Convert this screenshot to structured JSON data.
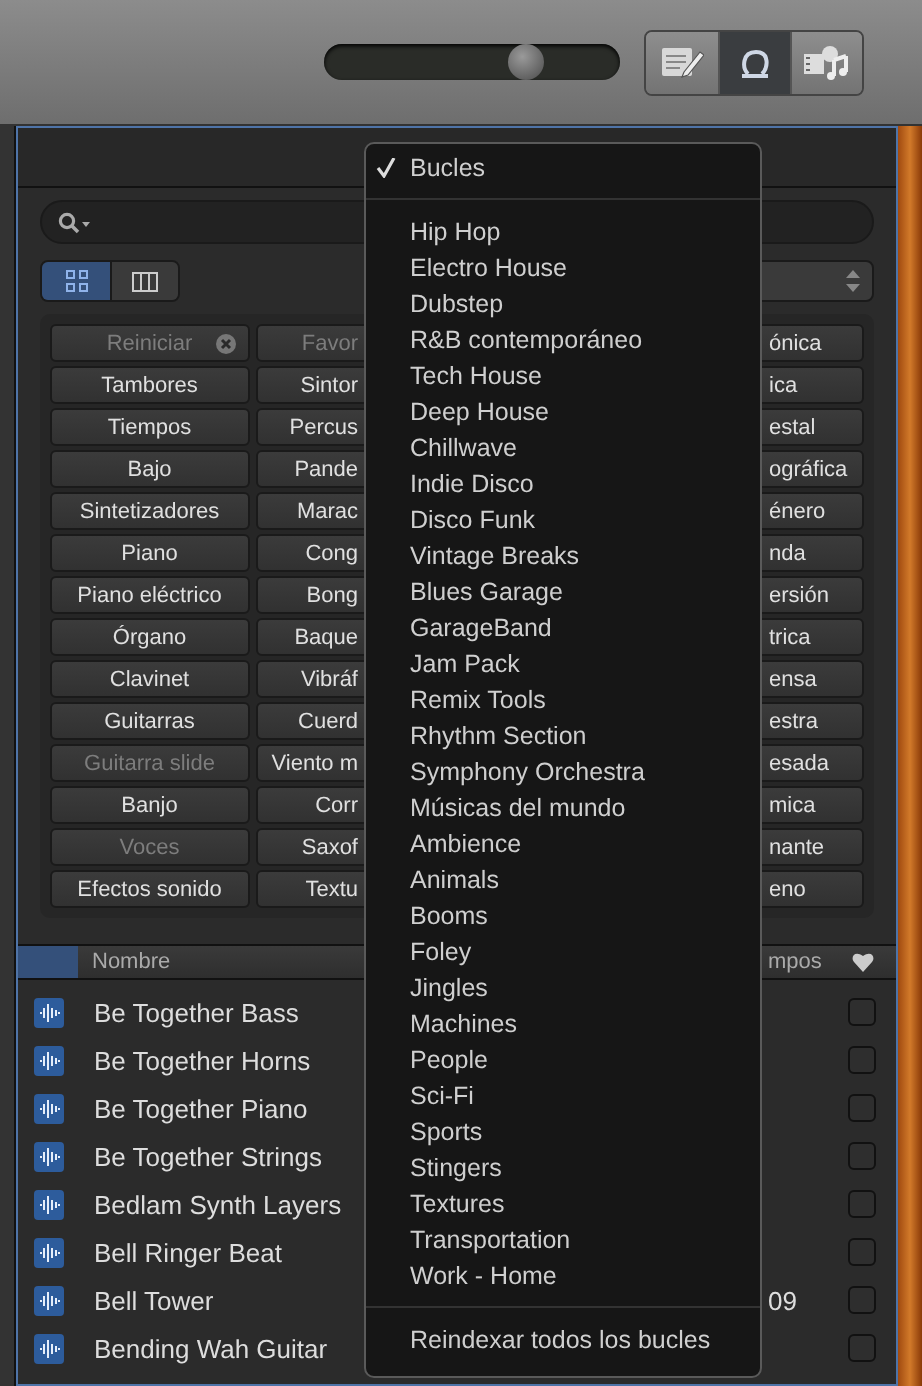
{
  "toolbar": {
    "slider": {
      "level": 0.68
    },
    "view_buttons": [
      {
        "kind": "editor",
        "selected": false
      },
      {
        "kind": "loops",
        "selected": true
      },
      {
        "kind": "media",
        "selected": false
      }
    ]
  },
  "view_toggle": [
    {
      "kind": "grid",
      "selected": true
    },
    {
      "kind": "columns",
      "selected": false
    }
  ],
  "keyword_columns": [
    [
      {
        "label": "Reiniciar",
        "disabled": true,
        "kind": "reset"
      },
      {
        "label": "Tambores",
        "disabled": false
      },
      {
        "label": "Tiempos",
        "disabled": false
      },
      {
        "label": "Bajo",
        "disabled": false
      },
      {
        "label": "Sintetizadores",
        "disabled": false
      },
      {
        "label": "Piano",
        "disabled": false
      },
      {
        "label": "Piano eléctrico",
        "disabled": false
      },
      {
        "label": "Órgano",
        "disabled": false
      },
      {
        "label": "Clavinet",
        "disabled": false
      },
      {
        "label": "Guitarras",
        "disabled": false
      },
      {
        "label": "Guitarra slide",
        "disabled": true
      },
      {
        "label": "Banjo",
        "disabled": false
      },
      {
        "label": "Voces",
        "disabled": true
      },
      {
        "label": "Efectos sonido",
        "disabled": false
      }
    ],
    [
      {
        "label": "Favor",
        "disabled": true
      },
      {
        "label": "Sintor",
        "disabled": false
      },
      {
        "label": "Percus",
        "disabled": false
      },
      {
        "label": "Pande",
        "disabled": false
      },
      {
        "label": "Marac",
        "disabled": false
      },
      {
        "label": "Cong",
        "disabled": false
      },
      {
        "label": "Bong",
        "disabled": false
      },
      {
        "label": "Baque",
        "disabled": false
      },
      {
        "label": "Vibráf",
        "disabled": false
      },
      {
        "label": "Cuerd",
        "disabled": false
      },
      {
        "label": "Viento m",
        "disabled": false
      },
      {
        "label": "Corr",
        "disabled": false
      },
      {
        "label": "Saxof",
        "disabled": false
      },
      {
        "label": "Textu",
        "disabled": false
      }
    ],
    [
      {
        "label": "ónica",
        "disabled": false
      },
      {
        "label": "ica",
        "disabled": false
      },
      {
        "label": "estal",
        "disabled": false
      },
      {
        "label": "ográfica",
        "disabled": false
      },
      {
        "label": "énero",
        "disabled": false
      },
      {
        "label": "nda",
        "disabled": false
      },
      {
        "label": "ersión",
        "disabled": false
      },
      {
        "label": "trica",
        "disabled": false
      },
      {
        "label": "ensa",
        "disabled": false
      },
      {
        "label": "estra",
        "disabled": false
      },
      {
        "label": "esada",
        "disabled": false
      },
      {
        "label": "mica",
        "disabled": false
      },
      {
        "label": "nante",
        "disabled": false
      },
      {
        "label": "eno",
        "disabled": false
      }
    ]
  ],
  "table": {
    "columns": [
      "Nombre",
      "mpos"
    ],
    "rows": [
      {
        "name": "Be Together Bass",
        "favorite": false
      },
      {
        "name": "Be Together Horns",
        "favorite": false
      },
      {
        "name": "Be Together Piano",
        "favorite": false
      },
      {
        "name": "Be Together Strings",
        "favorite": false
      },
      {
        "name": "Bedlam Synth Layers",
        "favorite": false
      },
      {
        "name": "Bell Ringer Beat",
        "favorite": false
      },
      {
        "name": "Bell Tower",
        "column_3": "09",
        "favorite": false
      },
      {
        "name": "Bending Wah Guitar",
        "favorite": false
      }
    ]
  },
  "menu": {
    "sections": [
      [
        {
          "label": "Bucles",
          "checked": true
        }
      ],
      [
        {
          "label": "Hip Hop",
          "checked": false
        },
        {
          "label": "Electro House",
          "checked": false
        },
        {
          "label": "Dubstep",
          "checked": false
        },
        {
          "label": "R&B contemporáneo",
          "checked": false
        },
        {
          "label": "Tech House",
          "checked": false
        },
        {
          "label": "Deep House",
          "checked": false
        },
        {
          "label": "Chillwave",
          "checked": false
        },
        {
          "label": "Indie Disco",
          "checked": false
        },
        {
          "label": "Disco Funk",
          "checked": false
        },
        {
          "label": "Vintage Breaks",
          "checked": false
        },
        {
          "label": "Blues Garage",
          "checked": false
        },
        {
          "label": "GarageBand",
          "checked": false
        },
        {
          "label": "Jam Pack",
          "checked": false
        },
        {
          "label": "Remix Tools",
          "checked": false
        },
        {
          "label": "Rhythm Section",
          "checked": false
        },
        {
          "label": "Symphony Orchestra",
          "checked": false
        },
        {
          "label": "Músicas del mundo",
          "checked": false
        },
        {
          "label": "Ambience",
          "checked": false
        },
        {
          "label": "Animals",
          "checked": false
        },
        {
          "label": "Booms",
          "checked": false
        },
        {
          "label": "Foley",
          "checked": false
        },
        {
          "label": "Jingles",
          "checked": false
        },
        {
          "label": "Machines",
          "checked": false
        },
        {
          "label": "People",
          "checked": false
        },
        {
          "label": "Sci-Fi",
          "checked": false
        },
        {
          "label": "Sports",
          "checked": false
        },
        {
          "label": "Stingers",
          "checked": false
        },
        {
          "label": "Textures",
          "checked": false
        },
        {
          "label": "Transportation",
          "checked": false
        },
        {
          "label": "Work - Home",
          "checked": false
        }
      ],
      [
        {
          "label": "Reindexar todos los bucles",
          "checked": false
        }
      ]
    ]
  }
}
